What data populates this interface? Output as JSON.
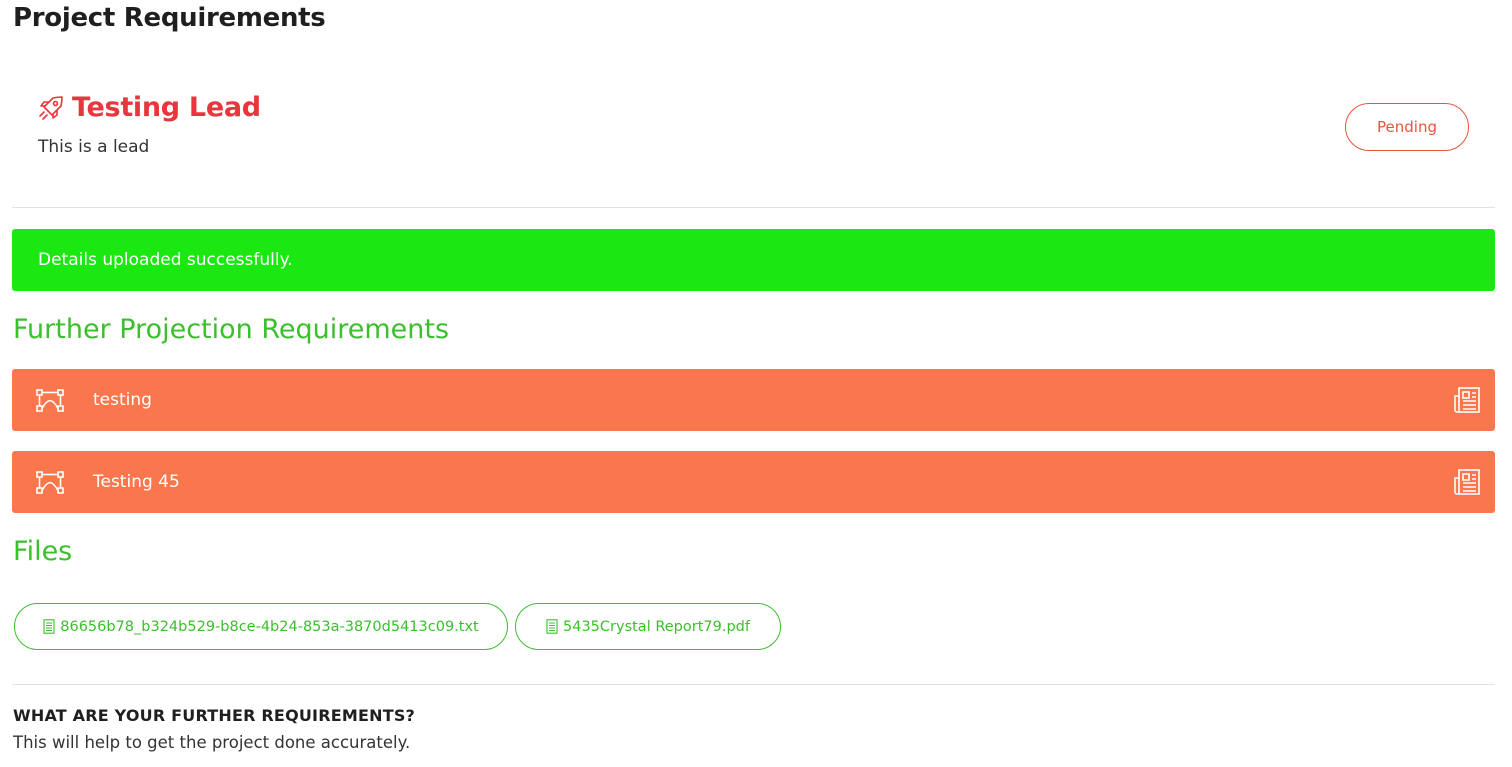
{
  "page": {
    "title": "Project Requirements"
  },
  "lead": {
    "icon": "rocket-icon",
    "title": "Testing Lead",
    "description": "This is a lead",
    "status": "Pending",
    "accent_color": "#e8363c"
  },
  "alert": {
    "message": "Details uploaded successfully.",
    "color": "#1ce811"
  },
  "further_requirements": {
    "heading": "Further Projection Requirements",
    "row_color": "#fa774e",
    "items": [
      {
        "label": "testing",
        "left_icon": "vector-nodes-icon",
        "right_icon": "newspaper-icon"
      },
      {
        "label": "Testing 45",
        "left_icon": "vector-nodes-icon",
        "right_icon": "newspaper-icon"
      }
    ]
  },
  "files": {
    "heading": "Files",
    "items": [
      {
        "name": "86656b78_b324b529-b8ce-4b24-853a-3870d5413c09.txt",
        "icon": "file-text-icon"
      },
      {
        "name": "5435Crystal Report79.pdf",
        "icon": "file-text-icon"
      }
    ],
    "color": "#3bbf2c"
  },
  "further_question": {
    "title": "WHAT ARE YOUR FURTHER REQUIREMENTS?",
    "help": "This will help to get the project done accurately."
  }
}
